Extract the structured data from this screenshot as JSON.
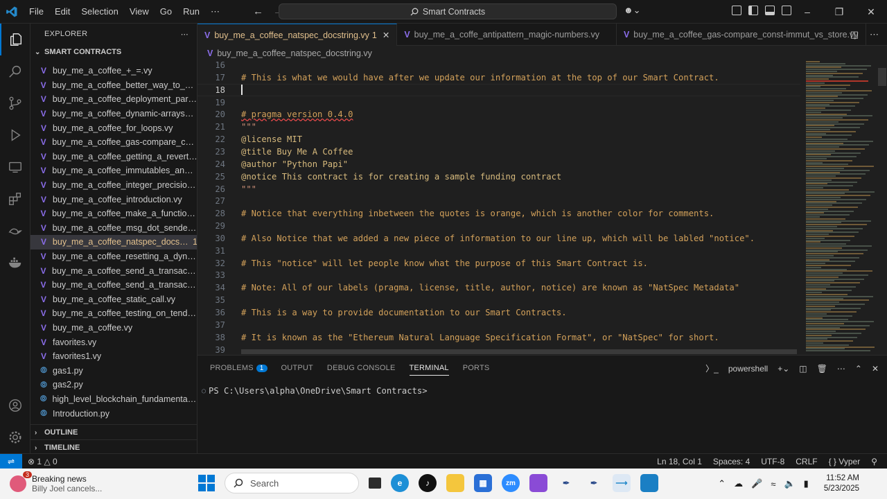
{
  "titlebar": {
    "menu": [
      "File",
      "Edit",
      "Selection",
      "View",
      "Go",
      "Run",
      "⋯"
    ],
    "search": "Smart Contracts",
    "icons": [
      "vscode-logo-icon",
      "search-icon",
      "copilot-icon",
      "layout-icon",
      "minimize-icon",
      "restore-icon",
      "close-icon"
    ]
  },
  "sidebar": {
    "title": "EXPLORER",
    "more": "⋯",
    "folder": "SMART CONTRACTS",
    "files": [
      {
        "name": "buy_me_a_coffee_+_=.vy",
        "type": "vy"
      },
      {
        "name": "buy_me_a_coffee_better_way_to_sen...",
        "type": "vy"
      },
      {
        "name": "buy_me_a_coffee_deployment_para...",
        "type": "vy"
      },
      {
        "name": "buy_me_a_coffee_dynamic-arrays_vs...",
        "type": "vy"
      },
      {
        "name": "buy_me_a_coffee_for_loops.vy",
        "type": "vy"
      },
      {
        "name": "buy_me_a_coffee_gas-compare_cons...",
        "type": "vy"
      },
      {
        "name": "buy_me_a_coffee_getting_a_revert.vy",
        "type": "vy"
      },
      {
        "name": "buy_me_a_coffee_immutables_and_c...",
        "type": "vy"
      },
      {
        "name": "buy_me_a_coffee_integer_precision.vy",
        "type": "vy"
      },
      {
        "name": "buy_me_a_coffee_introduction.vy",
        "type": "vy"
      },
      {
        "name": "buy_me_a_coffee_make_a_function_c...",
        "type": "vy"
      },
      {
        "name": "buy_me_a_coffee_msg_dot_sender.vy",
        "type": "vy"
      },
      {
        "name": "buy_me_a_coffee_natspec_docst...",
        "type": "vy",
        "badge": "1",
        "selected": true
      },
      {
        "name": "buy_me_a_coffee_resetting_a_dynam...",
        "type": "vy"
      },
      {
        "name": "buy_me_a_coffee_send_a_transaction...",
        "type": "vy"
      },
      {
        "name": "buy_me_a_coffee_send_a_transaction...",
        "type": "vy"
      },
      {
        "name": "buy_me_a_coffee_static_call.vy",
        "type": "vy"
      },
      {
        "name": "buy_me_a_coffee_testing_on_tenderl...",
        "type": "vy"
      },
      {
        "name": "buy_me_a_coffee.vy",
        "type": "vy"
      },
      {
        "name": "favorites.vy",
        "type": "vy"
      },
      {
        "name": "favorites1.vy",
        "type": "vy"
      },
      {
        "name": "gas1.py",
        "type": "py"
      },
      {
        "name": "gas2.py",
        "type": "py"
      },
      {
        "name": "high_level_blockchain_fundamentals....",
        "type": "py"
      },
      {
        "name": "Introduction.py",
        "type": "py"
      }
    ],
    "outline": "OUTLINE",
    "timeline": "TIMELINE"
  },
  "tabs": [
    {
      "label": "buy_me_a_coffee_natspec_docstring.vy",
      "badge": "1",
      "active": true
    },
    {
      "label": "buy_me_a_coffe_antipattern_magic-numbers.vy",
      "active": false
    },
    {
      "label": "buy_me_a_coffee_gas-compare_const-immut_vs_store.vy",
      "active": false
    }
  ],
  "breadcrumb": "buy_me_a_coffee_natspec_docstring.vy",
  "editor": {
    "lines": [
      {
        "n": "16",
        "text": "",
        "kind": "plain"
      },
      {
        "n": "17",
        "text": "# This is what we would have after we update our information at the top of our Smart Contract.",
        "kind": "comment"
      },
      {
        "n": "18",
        "text": "",
        "kind": "plain",
        "current": true
      },
      {
        "n": "19",
        "text": "",
        "kind": "plain"
      },
      {
        "n": "20",
        "text": "# pragma version 0.4.0",
        "kind": "comment",
        "squiggle": true
      },
      {
        "n": "21",
        "text": "\"\"\"",
        "kind": "str"
      },
      {
        "n": "22",
        "text": "@license MIT",
        "kind": "decor"
      },
      {
        "n": "23",
        "text": "@title Buy Me A Coffee",
        "kind": "decor"
      },
      {
        "n": "24",
        "text": "@author \"Python Papi\"",
        "kind": "decor"
      },
      {
        "n": "25",
        "text": "@notice This contract is for creating a sample funding contract",
        "kind": "decor"
      },
      {
        "n": "26",
        "text": "\"\"\"",
        "kind": "str"
      },
      {
        "n": "27",
        "text": "",
        "kind": "plain"
      },
      {
        "n": "28",
        "text": "# Notice that everything inbetween the quotes is orange, which is another color for comments.",
        "kind": "comment"
      },
      {
        "n": "29",
        "text": "",
        "kind": "plain"
      },
      {
        "n": "30",
        "text": "# Also Notice that we added a new piece of information to our line up, which will be labled \"notice\".",
        "kind": "comment"
      },
      {
        "n": "31",
        "text": "",
        "kind": "plain"
      },
      {
        "n": "32",
        "text": "# This \"notice\" will let people know what the purpose of this Smart Contract is.",
        "kind": "comment"
      },
      {
        "n": "33",
        "text": "",
        "kind": "plain"
      },
      {
        "n": "34",
        "text": "# Note: All of our labels (pragma, license, title, author, notice) are known as \"NatSpec Metadata\"",
        "kind": "comment"
      },
      {
        "n": "35",
        "text": "",
        "kind": "plain"
      },
      {
        "n": "36",
        "text": "# This is a way to provide documentation to our Smart Contracts.",
        "kind": "comment"
      },
      {
        "n": "37",
        "text": "",
        "kind": "plain"
      },
      {
        "n": "38",
        "text": "# It is known as the \"Ethereum Natural Language Specification Format\", or \"NatSpec\" for short.",
        "kind": "comment"
      },
      {
        "n": "39",
        "text": "",
        "kind": "plain"
      }
    ]
  },
  "panel": {
    "tabs": [
      "PROBLEMS",
      "OUTPUT",
      "DEBUG CONSOLE",
      "TERMINAL",
      "PORTS"
    ],
    "problems_count": "1",
    "active_tab": "TERMINAL",
    "shell": "powershell",
    "prompt": "PS C:\\Users\\alpha\\OneDrive\\Smart Contracts>"
  },
  "statusbar": {
    "errors": "1",
    "warnings": "0",
    "position": "Ln 18, Col 1",
    "spaces": "Spaces: 4",
    "encoding": "UTF-8",
    "eol": "CRLF",
    "language": "Vyper"
  },
  "taskbar": {
    "news_title": "Breaking news",
    "news_sub": "Billy Joel cancels...",
    "news_badge": "3",
    "search": "Search",
    "time": "11:52 AM",
    "date": "5/23/2025"
  },
  "colors": {
    "accent": "#0078d4",
    "comment": "#d3a15a",
    "modified": "#e2c08d",
    "vyper_icon": "#8a6de9",
    "python_icon": "#4b8bbe"
  }
}
